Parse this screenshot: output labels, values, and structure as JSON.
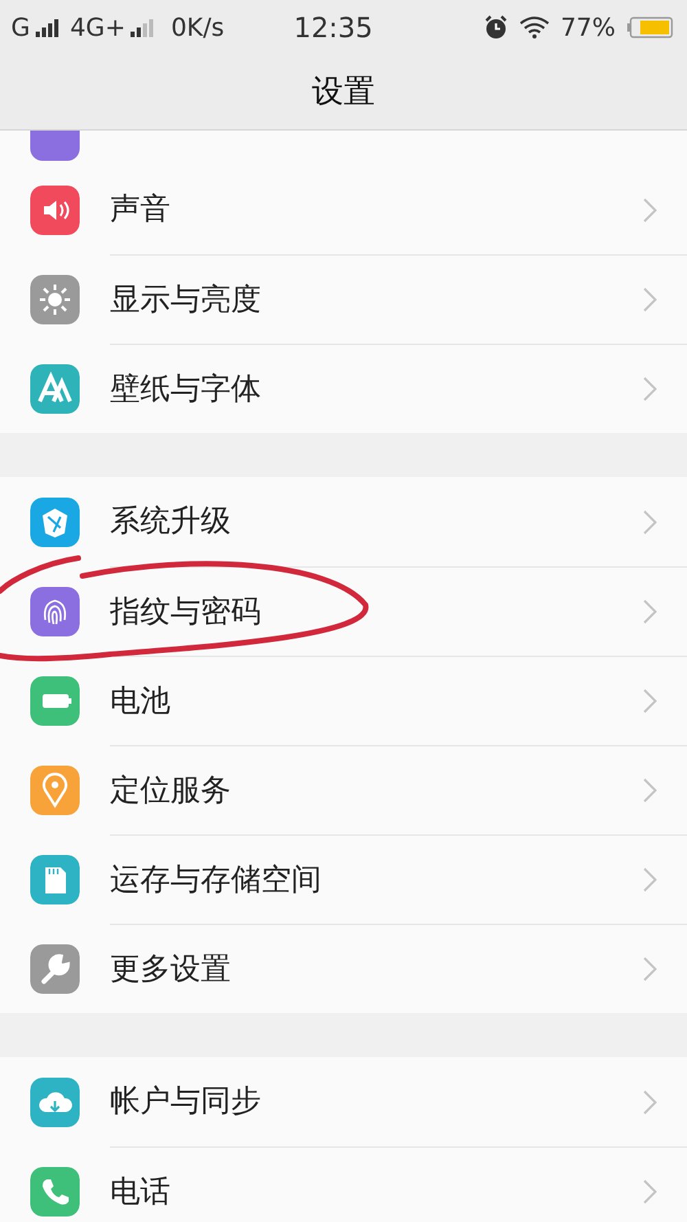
{
  "status_bar": {
    "carrier_1": "G",
    "carrier_2": "4G+",
    "speed": "0K/s",
    "time": "12:35",
    "battery": "77%"
  },
  "header": {
    "title": "设置"
  },
  "cut_item": {
    "color": "#8b6ee0"
  },
  "groups": [
    {
      "items": [
        {
          "label": "声音",
          "color": "#f04a5c"
        },
        {
          "label": "显示与亮度",
          "color": "#9a9a9a"
        },
        {
          "label": "壁纸与字体",
          "color": "#2db3b8"
        }
      ]
    },
    {
      "items": [
        {
          "label": "系统升级",
          "color": "#1aa8e4"
        },
        {
          "label": "指纹与密码",
          "color": "#8b6ee0"
        },
        {
          "label": "电池",
          "color": "#3fc07a"
        },
        {
          "label": "定位服务",
          "color": "#f8a33a"
        },
        {
          "label": "运存与存储空间",
          "color": "#2db3c4"
        },
        {
          "label": "更多设置",
          "color": "#9a9a9a"
        }
      ]
    },
    {
      "items": [
        {
          "label": "帐户与同步",
          "color": "#2db3c4"
        },
        {
          "label": "电话",
          "color": "#3fc07a"
        }
      ]
    }
  ]
}
